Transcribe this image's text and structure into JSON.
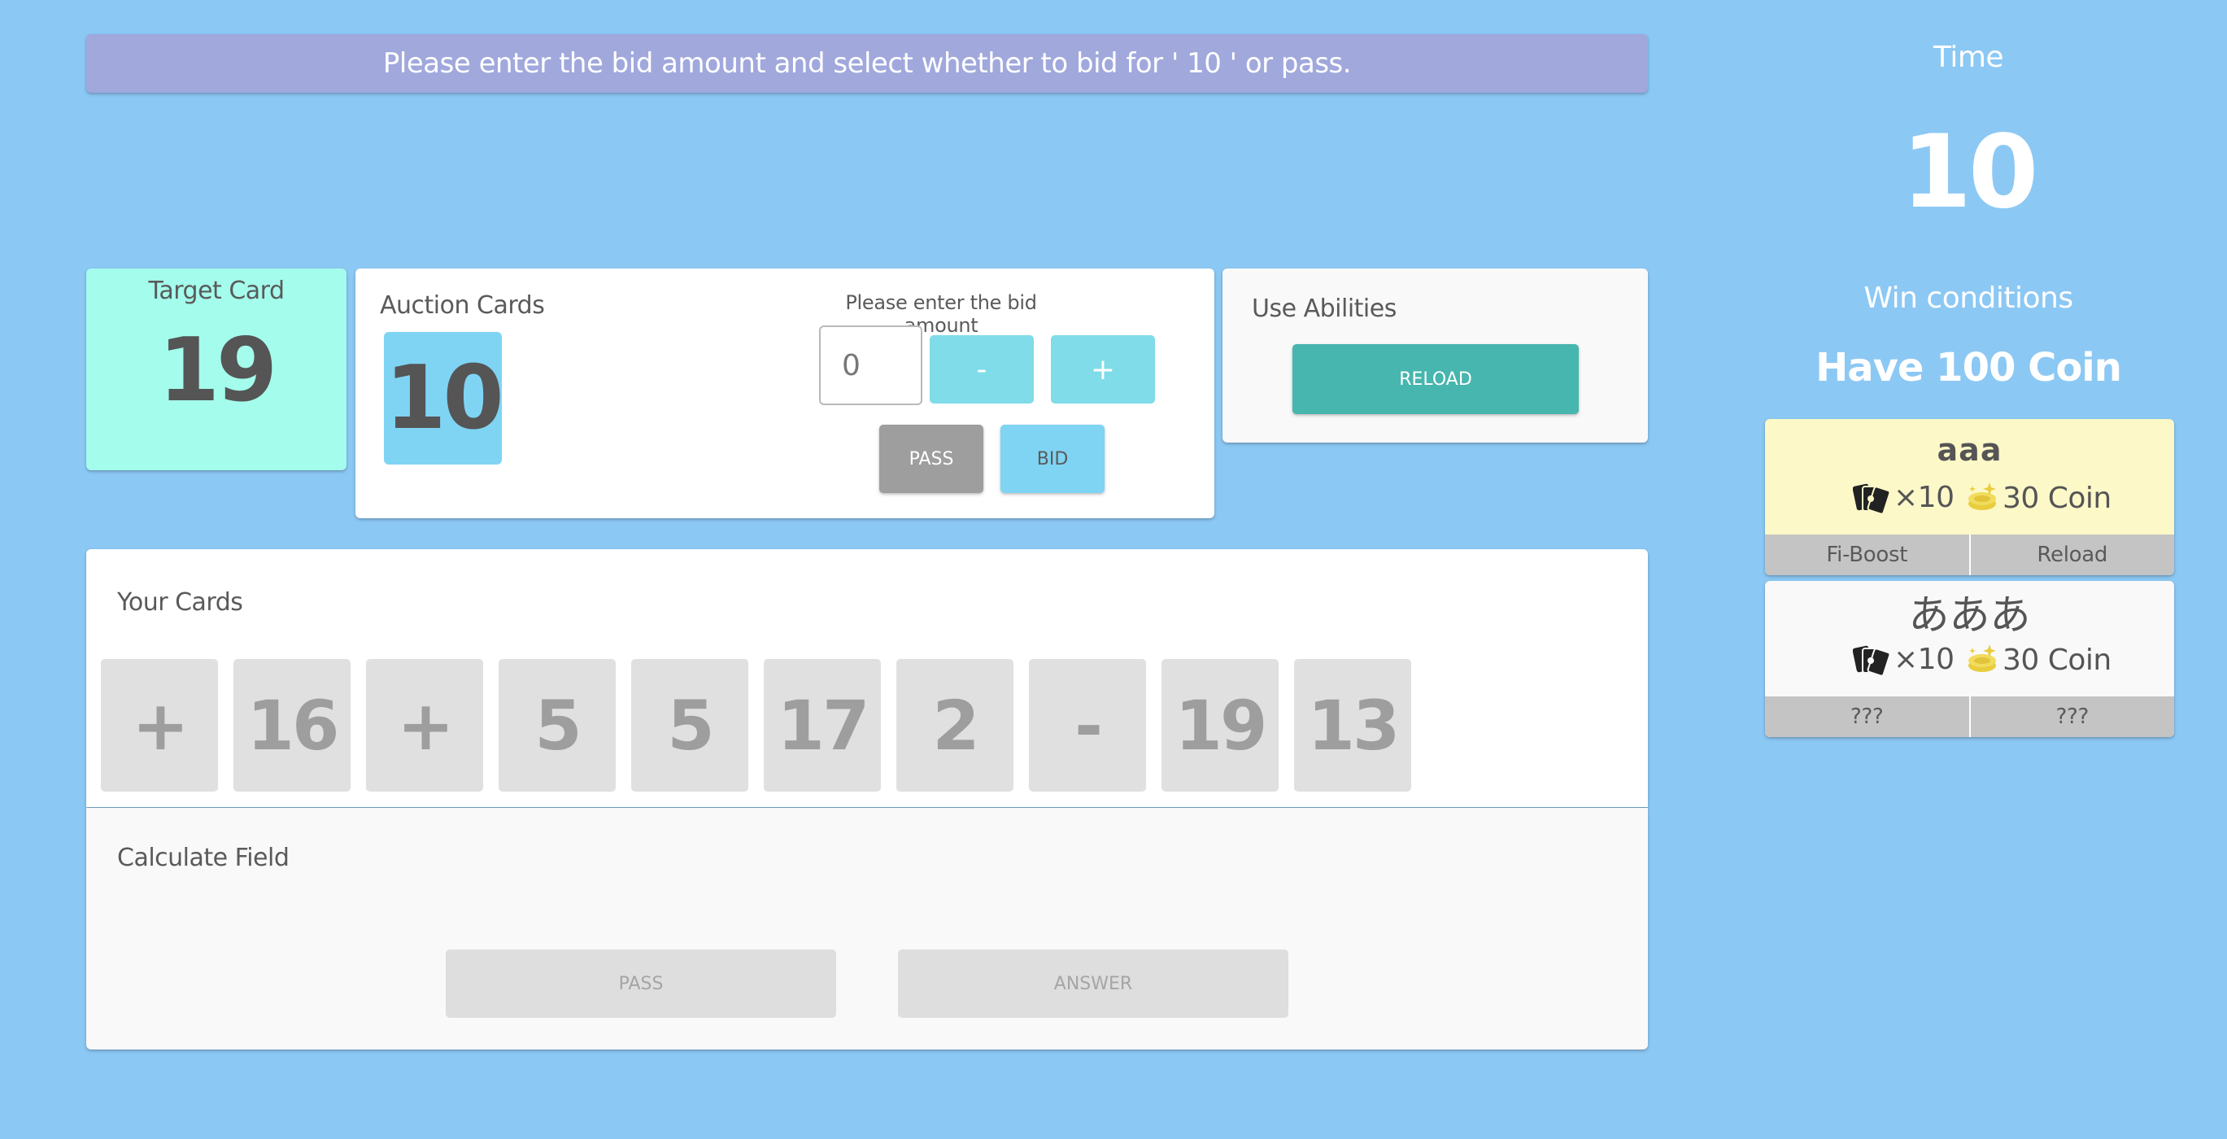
{
  "message": "Please enter the bid amount and select whether to bid for ' 10 ' or pass.",
  "target": {
    "label": "Target Card",
    "value": "19"
  },
  "auction": {
    "title": "Auction Cards",
    "card": "10",
    "bid_prompt": "Please enter the bid amount",
    "bid_value": "0",
    "minus_label": "-",
    "plus_label": "+",
    "pass_label": "PASS",
    "bid_label": "BID"
  },
  "abilities": {
    "title": "Use Abilities",
    "reload_label": "RELOAD"
  },
  "hand": {
    "title": "Your Cards",
    "cards": [
      "+",
      "16",
      "+",
      "5",
      "5",
      "17",
      "2",
      "-",
      "19",
      "13"
    ]
  },
  "calc": {
    "title": "Calculate Field",
    "pass_label": "PASS",
    "answer_label": "ANSWER"
  },
  "timer": {
    "label": "Time",
    "value": "10"
  },
  "win": {
    "label": "Win conditions",
    "value": "Have 100 Coin"
  },
  "players": [
    {
      "name": "aaa",
      "cards": "×10",
      "coins": "30 Coin",
      "abilities": [
        "Fi-Boost",
        "Reload"
      ],
      "card_icon": "cards-icon",
      "coin_icon": "coin-icon"
    },
    {
      "name": "あああ",
      "cards": "×10",
      "coins": "30 Coin",
      "abilities": [
        "???",
        "???"
      ],
      "card_icon": "cards-icon",
      "coin_icon": "coin-icon"
    }
  ],
  "colors": {
    "background": "#8cc8f4",
    "banner": "#a0a8dc",
    "target_card": "#a4fcec",
    "auction_card": "#7fd4f4",
    "reload_button": "#46b6ae",
    "player_1": "#fdf8c8"
  }
}
